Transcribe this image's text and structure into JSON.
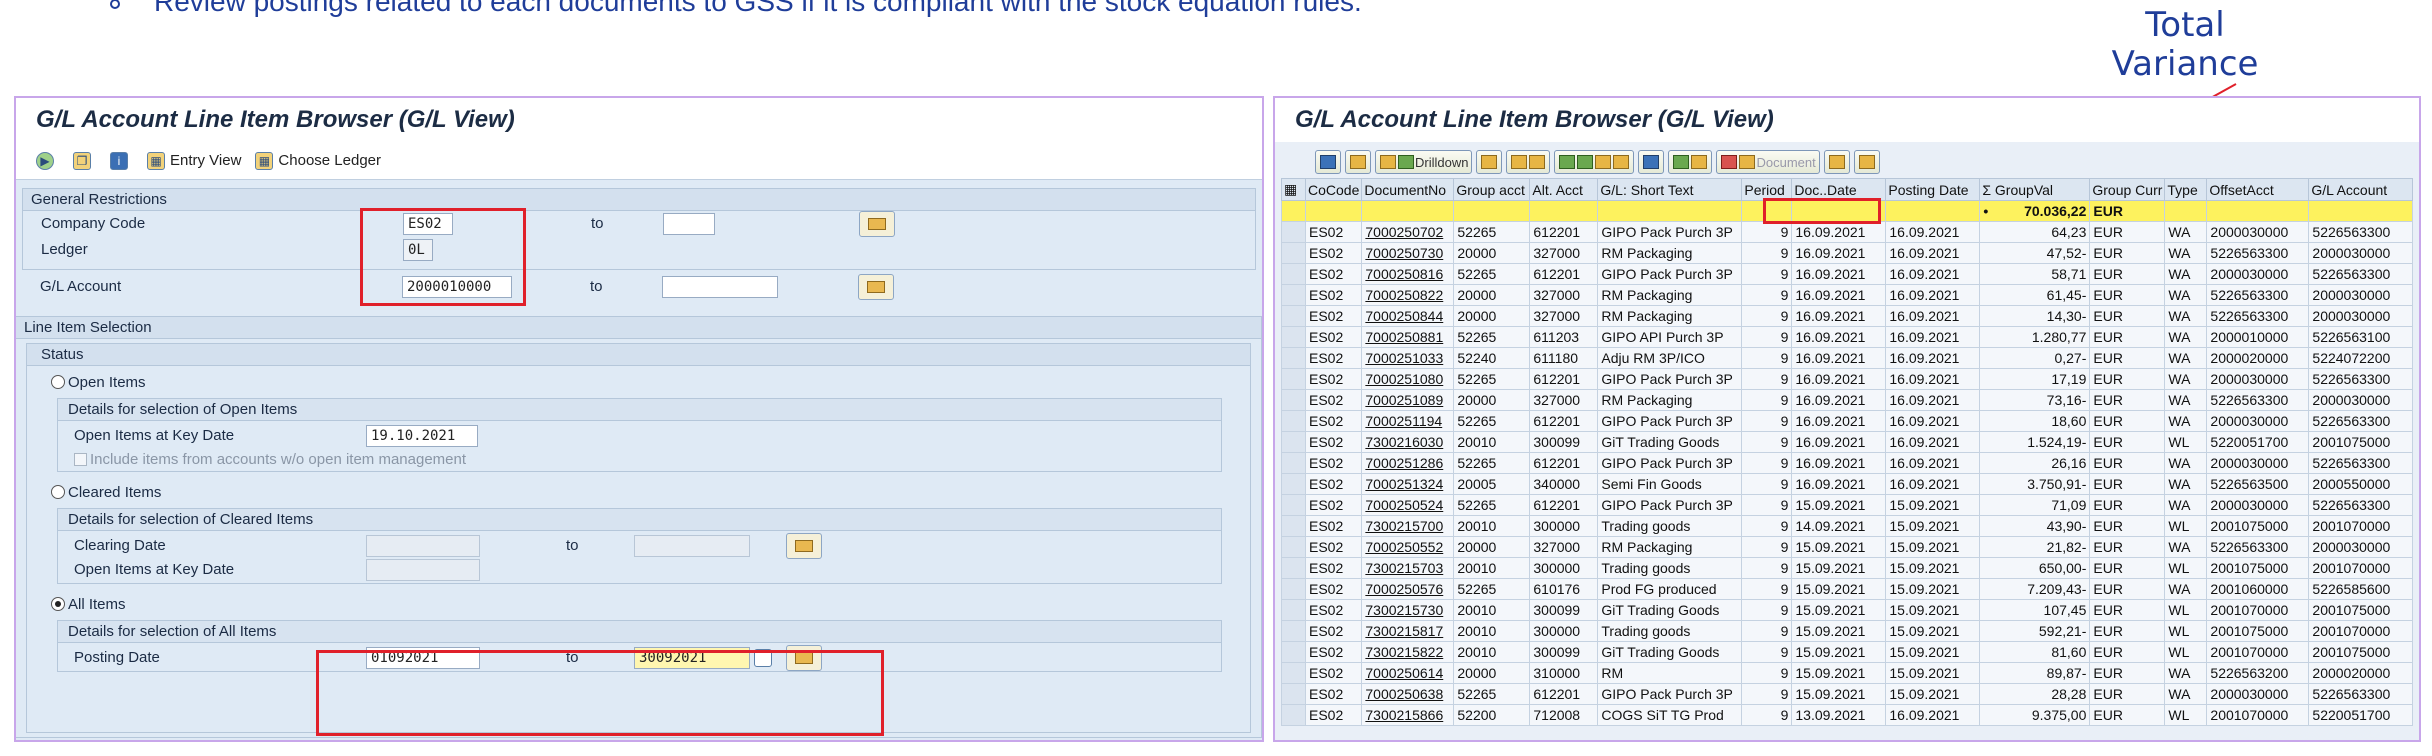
{
  "top_note": "Review postings related to each documents to GSS if it is compliant with the stock equation rules.",
  "variance_label": "Total Variance",
  "colors": {
    "accent": "#1f3d99",
    "highlight": "#e0202a",
    "panel_border": "#c8a6ea",
    "total_row": "#fdf25e"
  },
  "left": {
    "title": "G/L Account Line Item Browser (G/L View)",
    "toolbar": [
      {
        "icon": "execute-icon",
        "label": ""
      },
      {
        "icon": "copy-icon",
        "label": ""
      },
      {
        "icon": "info-icon",
        "label": ""
      },
      {
        "icon": "entry-view-icon",
        "label": "Entry View"
      },
      {
        "icon": "choose-ledger-icon",
        "label": "Choose Ledger"
      }
    ],
    "general": {
      "title": "General Restrictions",
      "company_code_label": "Company Code",
      "company_code": "ES02",
      "ledger_label": "Ledger",
      "ledger": "0L",
      "gl_account_label": "G/L Account",
      "gl_account": "2000010000",
      "to_label": "to"
    },
    "line_item": {
      "title": "Line Item Selection",
      "status_title": "Status",
      "open_items": "Open Items",
      "open_details": "Details for selection of Open Items",
      "open_key_date_label": "Open Items at Key Date",
      "open_key_date": "19.10.2021",
      "include_items_label": "Include items from accounts w/o open item management",
      "cleared_items": "Cleared Items",
      "cleared_details": "Details for selection of Cleared Items",
      "clearing_date_label": "Clearing Date",
      "cleared_open_key_label": "Open Items at Key Date",
      "all_items": "All Items",
      "all_details": "Details for selection of All Items",
      "posting_date_label": "Posting Date",
      "posting_from": "01092021",
      "posting_to": "30092021",
      "to_label": "to"
    }
  },
  "right": {
    "title": "G/L Account Line Item Browser (G/L View)",
    "toolbar": {
      "drilldown": "Drilldown",
      "document": "Document"
    },
    "columns": [
      "CoCode",
      "DocumentNo",
      "Group acct",
      "Alt. Acct",
      "G/L: Short Text",
      "Period",
      "Doc..Date",
      "Posting Date",
      "Σ GroupVal",
      "Group Curr",
      "Type",
      "OffsetAcct",
      "G/L Account"
    ],
    "total": {
      "bullet": "•",
      "value": "70.036,22",
      "currency": "EUR"
    },
    "rows": [
      [
        "ES02",
        "7000250702",
        "52265",
        "612201",
        "GIPO Pack Purch 3P",
        "9",
        "16.09.2021",
        "16.09.2021",
        "64,23",
        "EUR",
        "WA",
        "2000030000",
        "5226563300"
      ],
      [
        "ES02",
        "7000250730",
        "20000",
        "327000",
        "RM Packaging",
        "9",
        "16.09.2021",
        "16.09.2021",
        "47,52-",
        "EUR",
        "WA",
        "5226563300",
        "2000030000"
      ],
      [
        "ES02",
        "7000250816",
        "52265",
        "612201",
        "GIPO Pack Purch 3P",
        "9",
        "16.09.2021",
        "16.09.2021",
        "58,71",
        "EUR",
        "WA",
        "2000030000",
        "5226563300"
      ],
      [
        "ES02",
        "7000250822",
        "20000",
        "327000",
        "RM Packaging",
        "9",
        "16.09.2021",
        "16.09.2021",
        "61,45-",
        "EUR",
        "WA",
        "5226563300",
        "2000030000"
      ],
      [
        "ES02",
        "7000250844",
        "20000",
        "327000",
        "RM Packaging",
        "9",
        "16.09.2021",
        "16.09.2021",
        "14,30-",
        "EUR",
        "WA",
        "5226563300",
        "2000030000"
      ],
      [
        "ES02",
        "7000250881",
        "52265",
        "611203",
        "GIPO API Purch 3P",
        "9",
        "16.09.2021",
        "16.09.2021",
        "1.280,77",
        "EUR",
        "WA",
        "2000010000",
        "5226563100"
      ],
      [
        "ES02",
        "7000251033",
        "52240",
        "611180",
        "Adju RM 3P/ICO",
        "9",
        "16.09.2021",
        "16.09.2021",
        "0,27-",
        "EUR",
        "WA",
        "2000020000",
        "5224072200"
      ],
      [
        "ES02",
        "7000251080",
        "52265",
        "612201",
        "GIPO Pack Purch 3P",
        "9",
        "16.09.2021",
        "16.09.2021",
        "17,19",
        "EUR",
        "WA",
        "2000030000",
        "5226563300"
      ],
      [
        "ES02",
        "7000251089",
        "20000",
        "327000",
        "RM Packaging",
        "9",
        "16.09.2021",
        "16.09.2021",
        "73,16-",
        "EUR",
        "WA",
        "5226563300",
        "2000030000"
      ],
      [
        "ES02",
        "7000251194",
        "52265",
        "612201",
        "GIPO Pack Purch 3P",
        "9",
        "16.09.2021",
        "16.09.2021",
        "18,60",
        "EUR",
        "WA",
        "2000030000",
        "5226563300"
      ],
      [
        "ES02",
        "7300216030",
        "20010",
        "300099",
        "GiT Trading Goods",
        "9",
        "16.09.2021",
        "16.09.2021",
        "1.524,19-",
        "EUR",
        "WL",
        "5220051700",
        "2001075000"
      ],
      [
        "ES02",
        "7000251286",
        "52265",
        "612201",
        "GIPO Pack Purch 3P",
        "9",
        "16.09.2021",
        "16.09.2021",
        "26,16",
        "EUR",
        "WA",
        "2000030000",
        "5226563300"
      ],
      [
        "ES02",
        "7000251324",
        "20005",
        "340000",
        "Semi Fin Goods",
        "9",
        "16.09.2021",
        "16.09.2021",
        "3.750,91-",
        "EUR",
        "WA",
        "5226563500",
        "2000550000"
      ],
      [
        "ES02",
        "7000250524",
        "52265",
        "612201",
        "GIPO Pack Purch 3P",
        "9",
        "15.09.2021",
        "15.09.2021",
        "71,09",
        "EUR",
        "WA",
        "2000030000",
        "5226563300"
      ],
      [
        "ES02",
        "7300215700",
        "20010",
        "300000",
        "Trading goods",
        "9",
        "14.09.2021",
        "15.09.2021",
        "43,90-",
        "EUR",
        "WL",
        "2001075000",
        "2001070000"
      ],
      [
        "ES02",
        "7000250552",
        "20000",
        "327000",
        "RM Packaging",
        "9",
        "15.09.2021",
        "15.09.2021",
        "21,82-",
        "EUR",
        "WA",
        "5226563300",
        "2000030000"
      ],
      [
        "ES02",
        "7300215703",
        "20010",
        "300000",
        "Trading goods",
        "9",
        "15.09.2021",
        "15.09.2021",
        "650,00-",
        "EUR",
        "WL",
        "2001075000",
        "2001070000"
      ],
      [
        "ES02",
        "7000250576",
        "52265",
        "610176",
        "Prod FG produced",
        "9",
        "15.09.2021",
        "15.09.2021",
        "7.209,43-",
        "EUR",
        "WA",
        "2001060000",
        "5226585600"
      ],
      [
        "ES02",
        "7300215730",
        "20010",
        "300099",
        "GiT Trading Goods",
        "9",
        "15.09.2021",
        "15.09.2021",
        "107,45",
        "EUR",
        "WL",
        "2001070000",
        "2001075000"
      ],
      [
        "ES02",
        "7300215817",
        "20010",
        "300000",
        "Trading goods",
        "9",
        "15.09.2021",
        "15.09.2021",
        "592,21-",
        "EUR",
        "WL",
        "2001075000",
        "2001070000"
      ],
      [
        "ES02",
        "7300215822",
        "20010",
        "300099",
        "GiT Trading Goods",
        "9",
        "15.09.2021",
        "15.09.2021",
        "81,60",
        "EUR",
        "WL",
        "2001070000",
        "2001075000"
      ],
      [
        "ES02",
        "7000250614",
        "20000",
        "310000",
        "RM",
        "9",
        "15.09.2021",
        "15.09.2021",
        "89,87-",
        "EUR",
        "WA",
        "5226563200",
        "2000020000"
      ],
      [
        "ES02",
        "7000250638",
        "52265",
        "612201",
        "GIPO Pack Purch 3P",
        "9",
        "15.09.2021",
        "15.09.2021",
        "28,28",
        "EUR",
        "WA",
        "2000030000",
        "5226563300"
      ],
      [
        "ES02",
        "7300215866",
        "52200",
        "712008",
        "COGS SiT TG Prod",
        "9",
        "13.09.2021",
        "16.09.2021",
        "9.375,00",
        "EUR",
        "WL",
        "2001070000",
        "5220051700"
      ]
    ]
  }
}
